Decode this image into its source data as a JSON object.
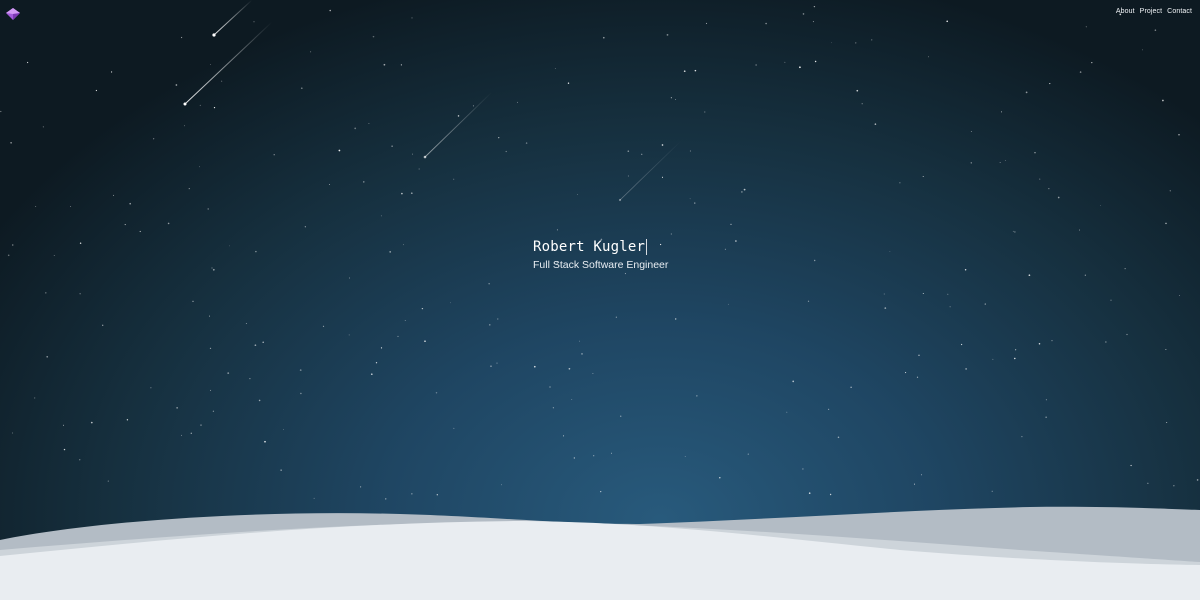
{
  "header": {
    "logo_icon": "purple-gem-logo-icon",
    "nav_items": [
      {
        "label": "About"
      },
      {
        "label": "Project"
      },
      {
        "label": "Contact"
      }
    ]
  },
  "hero": {
    "name": "Robert Kugler",
    "title": "Full Stack Software Engineer"
  },
  "colors": {
    "sky_top": "#0d1a22",
    "sky_center": "#285a7c",
    "snow": "#e9edf1",
    "snow_back": "#b3bcc5",
    "logo": "#b46be8"
  }
}
